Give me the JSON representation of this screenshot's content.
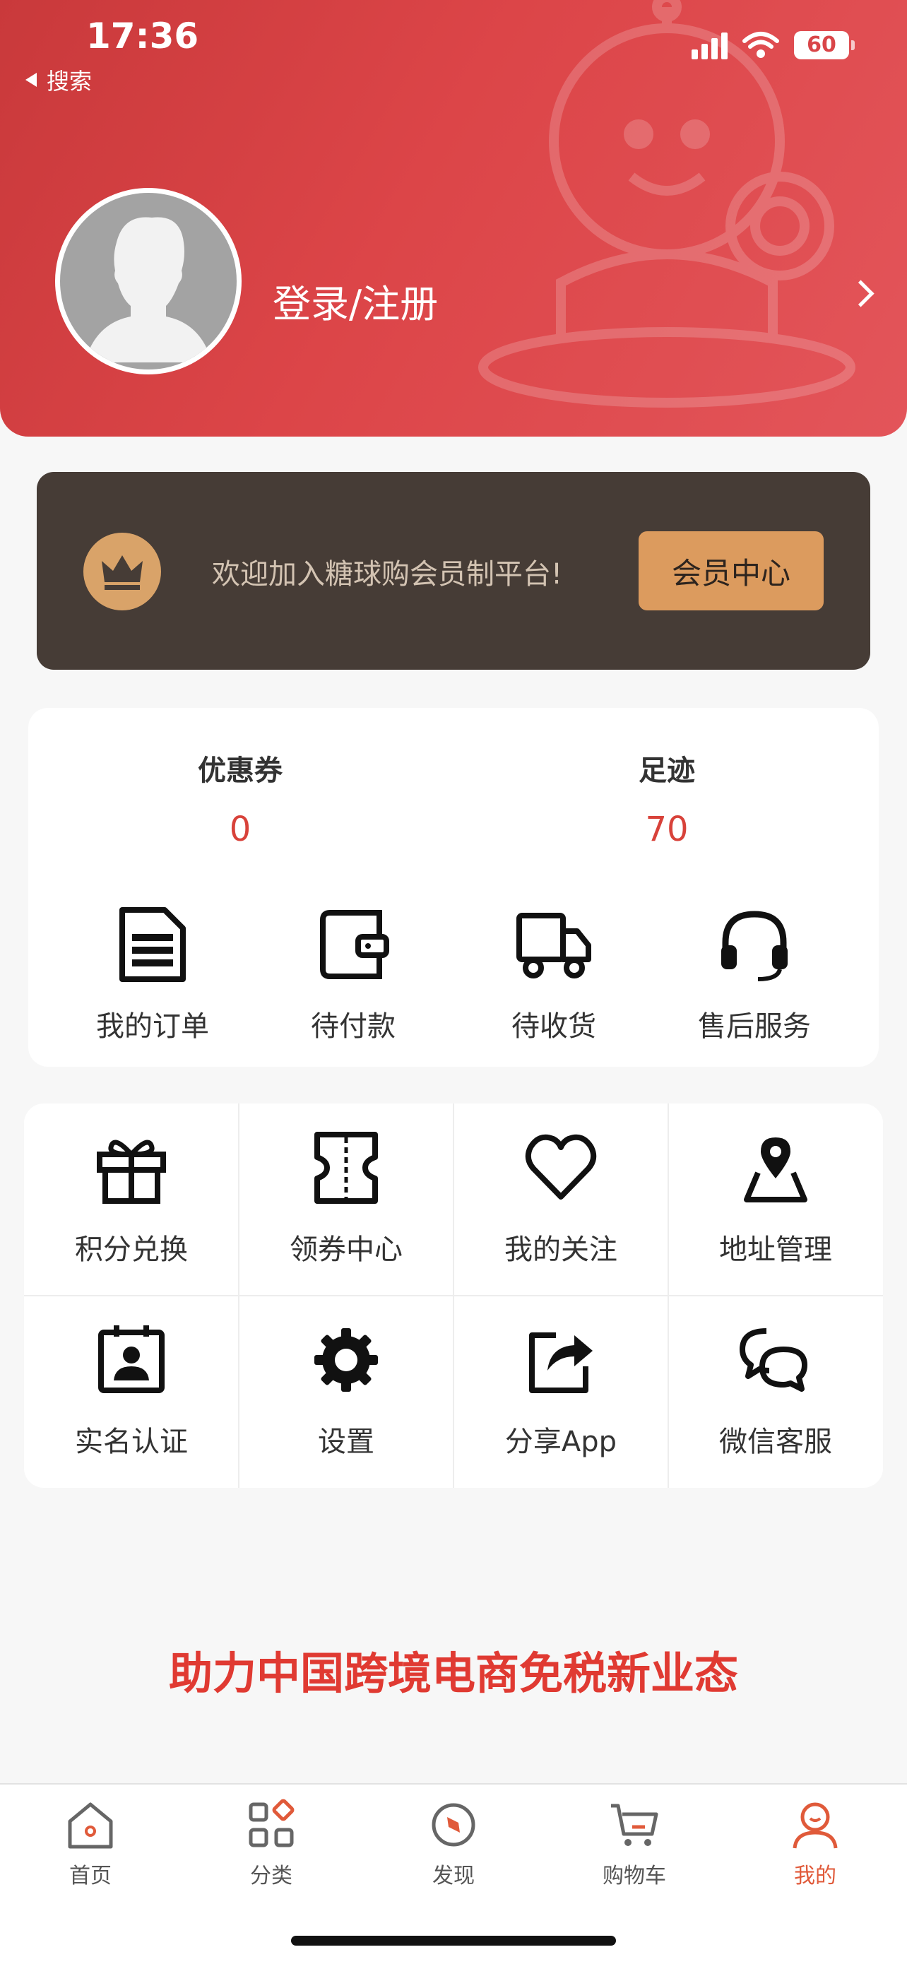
{
  "status_bar": {
    "time": "17:36",
    "back_label": "搜索",
    "battery": "60"
  },
  "header": {
    "login_label": "登录/注册"
  },
  "member": {
    "text": "欢迎加入糖球购会员制平台!",
    "button_label": "会员中心"
  },
  "stats": [
    {
      "label": "优惠券",
      "value": "0"
    },
    {
      "label": "足迹",
      "value": "70"
    }
  ],
  "orders": [
    {
      "label": "我的订单",
      "icon": "order-document-icon"
    },
    {
      "label": "待付款",
      "icon": "wallet-icon"
    },
    {
      "label": "待收货",
      "icon": "truck-icon"
    },
    {
      "label": "售后服务",
      "icon": "headset-icon"
    }
  ],
  "grid": [
    {
      "label": "积分兑换",
      "icon": "gift-icon"
    },
    {
      "label": "领券中心",
      "icon": "ticket-icon"
    },
    {
      "label": "我的关注",
      "icon": "heart-icon"
    },
    {
      "label": "地址管理",
      "icon": "map-pin-icon"
    },
    {
      "label": "实名认证",
      "icon": "id-card-icon"
    },
    {
      "label": "设置",
      "icon": "gear-icon"
    },
    {
      "label": "分享App",
      "icon": "share-icon"
    },
    {
      "label": "微信客服",
      "icon": "chat-bubbles-icon"
    }
  ],
  "slogan": "助力中国跨境电商免税新业态",
  "tabbar": {
    "items": [
      {
        "label": "首页",
        "icon": "home-icon"
      },
      {
        "label": "分类",
        "icon": "category-icon"
      },
      {
        "label": "发现",
        "icon": "compass-icon"
      },
      {
        "label": "购物车",
        "icon": "cart-icon"
      },
      {
        "label": "我的",
        "icon": "user-icon"
      }
    ],
    "active": "我的"
  },
  "colors": {
    "header_red": "#dc4548",
    "accent_red": "#d8423a",
    "member_bg": "#463c36",
    "member_gold": "#dc9b5e",
    "tab_active": "#e05a3a"
  }
}
